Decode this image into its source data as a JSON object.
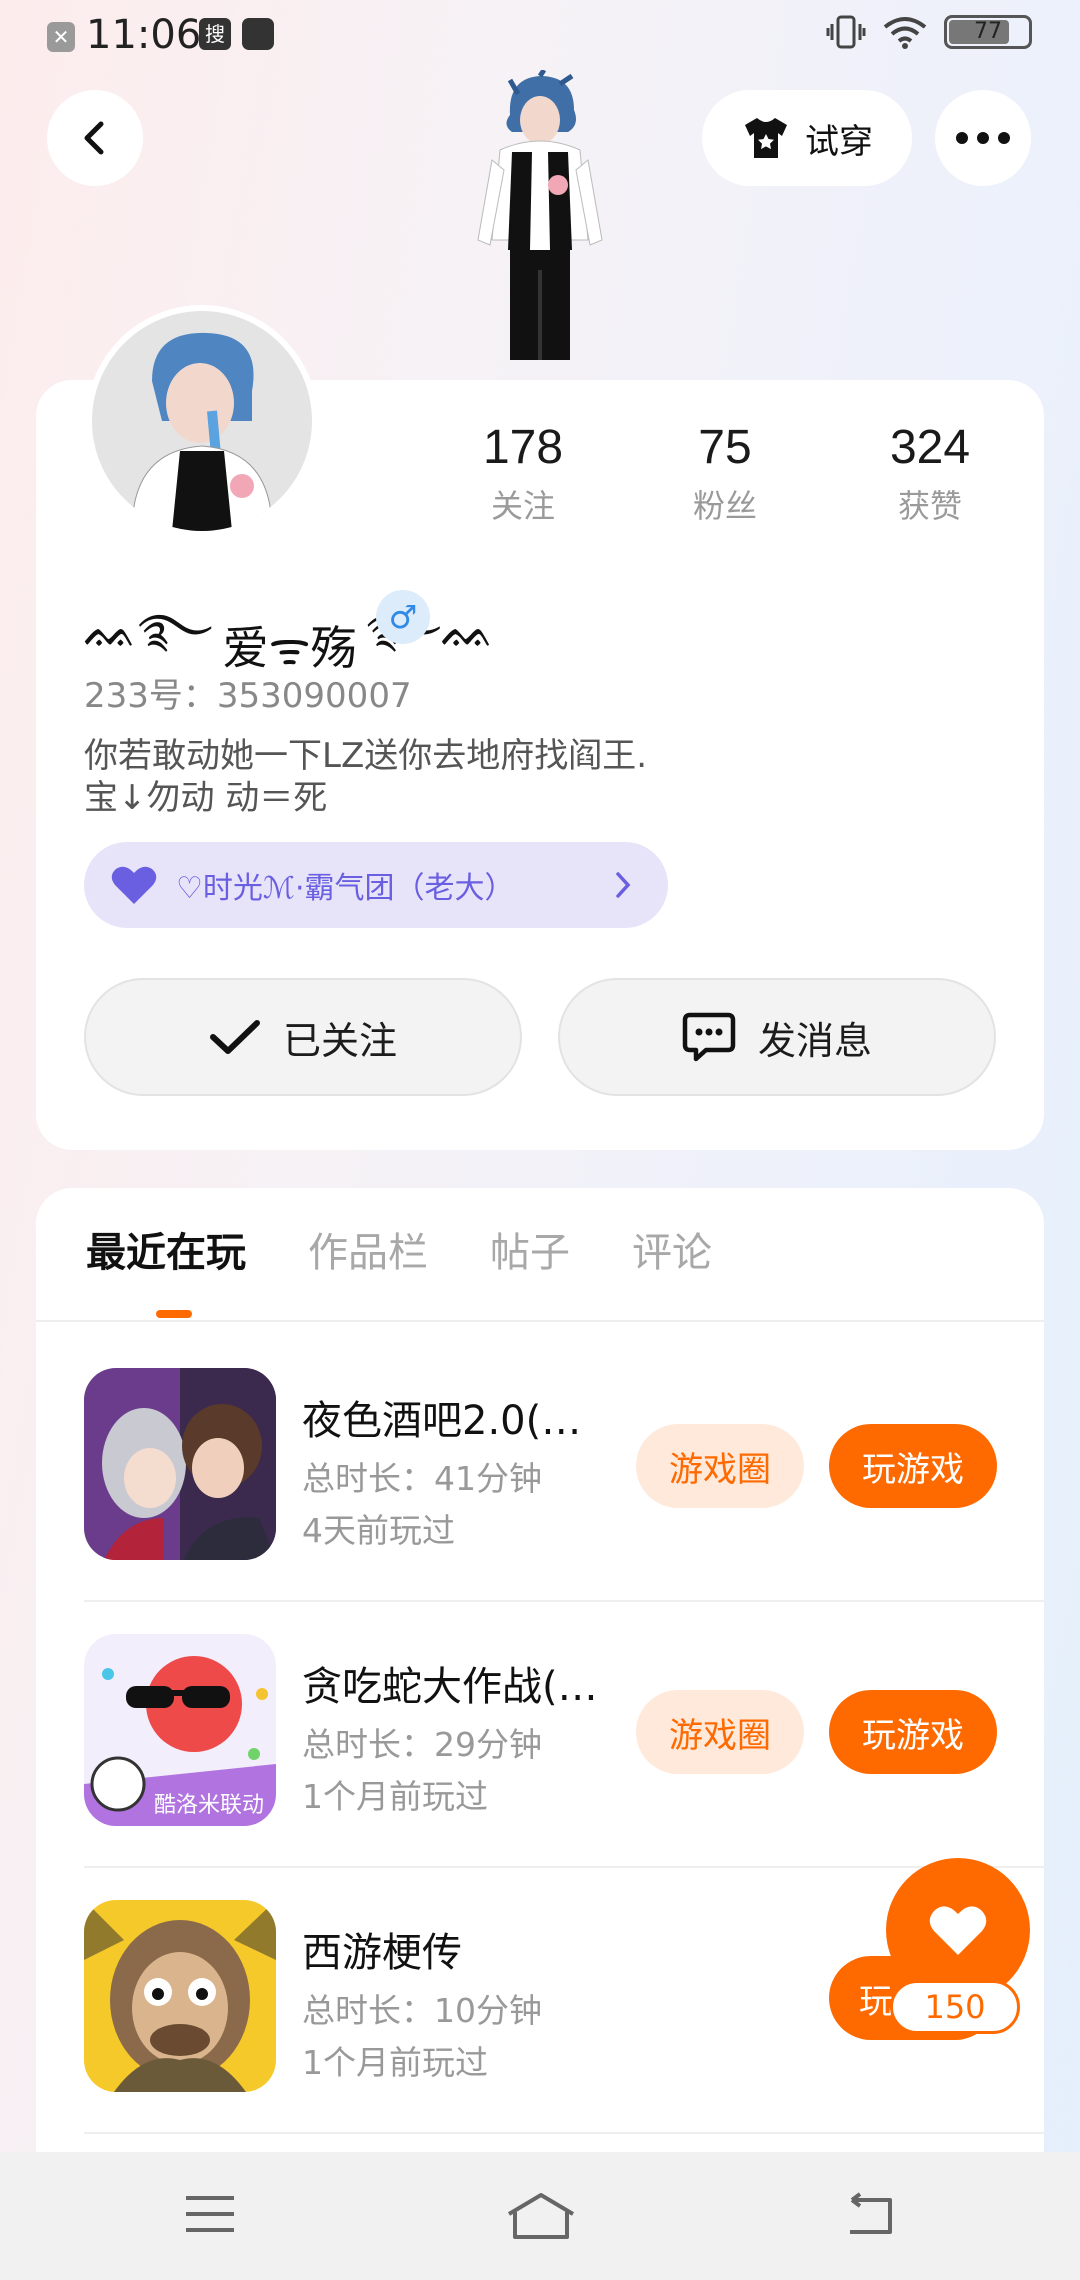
{
  "status_bar": {
    "time": "11:06",
    "search_badge": "搜",
    "battery": "77",
    "battery_level_percent": 77
  },
  "header": {
    "try_on_label": "试穿"
  },
  "profile": {
    "stats": [
      {
        "value": "178",
        "label": "关注"
      },
      {
        "value": "75",
        "label": "粉丝"
      },
      {
        "value": "324",
        "label": "获赞"
      }
    ],
    "nickname_deco_left": "ᨐ࿐",
    "nickname": "爱ᯤ殇",
    "nickname_deco_right": "࿐ᨐ",
    "gender_symbol": "♂",
    "uid": "233号：353090007",
    "bio_line1": "你若敢动她一下LZ送你去地府找阎王.",
    "bio_line2": "宝↓勿动  动＝死",
    "group_label": "♡时光ℳ·霸气团（老大）",
    "follow_label": "已关注",
    "message_label": "发消息"
  },
  "tabs": [
    {
      "label": "最近在玩",
      "active": true
    },
    {
      "label": "作品栏",
      "active": false
    },
    {
      "label": "帖子",
      "active": false
    },
    {
      "label": "评论",
      "active": false
    }
  ],
  "games": [
    {
      "title": "夜色酒吧2.0(…",
      "duration": "总时长：41分钟",
      "last_played": "4天前玩过",
      "circle_label": "游戏圈",
      "play_label": "玩游戏"
    },
    {
      "title": "贪吃蛇大作战(…",
      "duration": "总时长：29分钟",
      "last_played": "1个月前玩过",
      "circle_label": "游戏圈",
      "play_label": "玩游戏"
    },
    {
      "title": "西游梗传",
      "duration": "总时长：10分钟",
      "last_played": "1个月前玩过",
      "play_label": "玩"
    }
  ],
  "fab": {
    "count": "150"
  },
  "colors": {
    "accent": "#ff6a00",
    "accent_light": "#ffe9db",
    "group_bg": "#e7e4fa",
    "group_text": "#6a5fe0",
    "gender_blue": "#2f8ae8"
  }
}
